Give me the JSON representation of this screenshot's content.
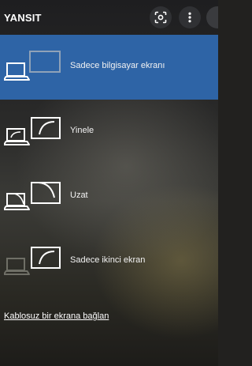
{
  "header": {
    "title": "YANSIT",
    "capture_icon": "screen-capture-icon",
    "more_icon": "more-vertical-icon"
  },
  "options": [
    {
      "label": "Sadece bilgisayar ekranı",
      "icon": "pc-screen-only-icon",
      "selected": true
    },
    {
      "label": "Yinele",
      "icon": "duplicate-icon",
      "selected": false
    },
    {
      "label": "Uzat",
      "icon": "extend-icon",
      "selected": false
    },
    {
      "label": "Sadece ikinci ekran",
      "icon": "second-screen-only-icon",
      "selected": false
    }
  ],
  "connect_link": "Kablosuz bir ekrana bağlan",
  "colors": {
    "selected_background": "#2e64a6",
    "panel_background": "#2b2b2a",
    "text": "#ffffff"
  }
}
